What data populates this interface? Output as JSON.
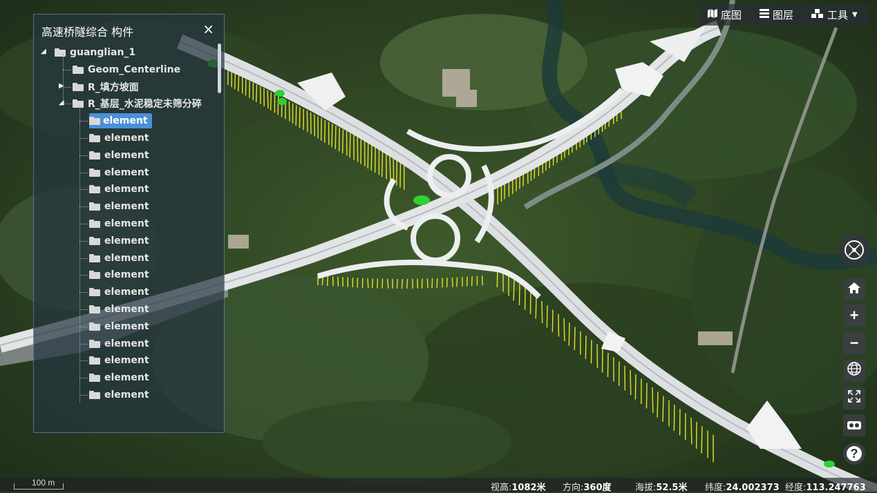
{
  "panel": {
    "title": "高速桥隧综合 构件",
    "close_label": "×",
    "tree": [
      {
        "label": "guanglian_1",
        "level": 0,
        "expander": "collapse",
        "selected": false
      },
      {
        "label": "Geom_Centerline",
        "level": 1,
        "expander": "none",
        "selected": false
      },
      {
        "label": "R_填方坡面",
        "level": 1,
        "expander": "expand",
        "selected": false
      },
      {
        "label": "R_基层_水泥稳定未筛分碎",
        "level": 1,
        "expander": "collapse",
        "selected": false
      },
      {
        "label": "element",
        "level": 2,
        "expander": "none",
        "selected": true
      },
      {
        "label": "element",
        "level": 2,
        "expander": "none",
        "selected": false
      },
      {
        "label": "element",
        "level": 2,
        "expander": "none",
        "selected": false
      },
      {
        "label": "element",
        "level": 2,
        "expander": "none",
        "selected": false
      },
      {
        "label": "element",
        "level": 2,
        "expander": "none",
        "selected": false
      },
      {
        "label": "element",
        "level": 2,
        "expander": "none",
        "selected": false
      },
      {
        "label": "element",
        "level": 2,
        "expander": "none",
        "selected": false
      },
      {
        "label": "element",
        "level": 2,
        "expander": "none",
        "selected": false
      },
      {
        "label": "element",
        "level": 2,
        "expander": "none",
        "selected": false
      },
      {
        "label": "element",
        "level": 2,
        "expander": "none",
        "selected": false
      },
      {
        "label": "element",
        "level": 2,
        "expander": "none",
        "selected": false
      },
      {
        "label": "element",
        "level": 2,
        "expander": "none",
        "selected": false
      },
      {
        "label": "element",
        "level": 2,
        "expander": "none",
        "selected": false
      },
      {
        "label": "element",
        "level": 2,
        "expander": "none",
        "selected": false
      },
      {
        "label": "element",
        "level": 2,
        "expander": "none",
        "selected": false
      },
      {
        "label": "element",
        "level": 2,
        "expander": "none",
        "selected": false
      },
      {
        "label": "element",
        "level": 2,
        "expander": "none",
        "selected": false
      }
    ]
  },
  "toolbar": {
    "basemap_label": "底图",
    "layers_label": "图层",
    "tools_label": "工具"
  },
  "controls": {
    "home_icon": "home-icon",
    "zoom_in_label": "+",
    "zoom_out_label": "−",
    "help_label": "?"
  },
  "status": {
    "view_height_label": "视高:",
    "view_height_value": "1082米",
    "heading_label": "方向:",
    "heading_value": "360度",
    "altitude_label": "海拔:",
    "altitude_value": "52.5米",
    "latitude_label": "纬度:",
    "latitude_value": "24.002373",
    "longitude_label": "经度:",
    "longitude_value": "113.247763"
  },
  "scale": {
    "label": "100 m"
  },
  "colors": {
    "panel_border": "#78aad2",
    "selected": "#4a90d9",
    "road": "#e8eaec",
    "pier": "#e6e22a",
    "highlight": "#2fd12f"
  }
}
